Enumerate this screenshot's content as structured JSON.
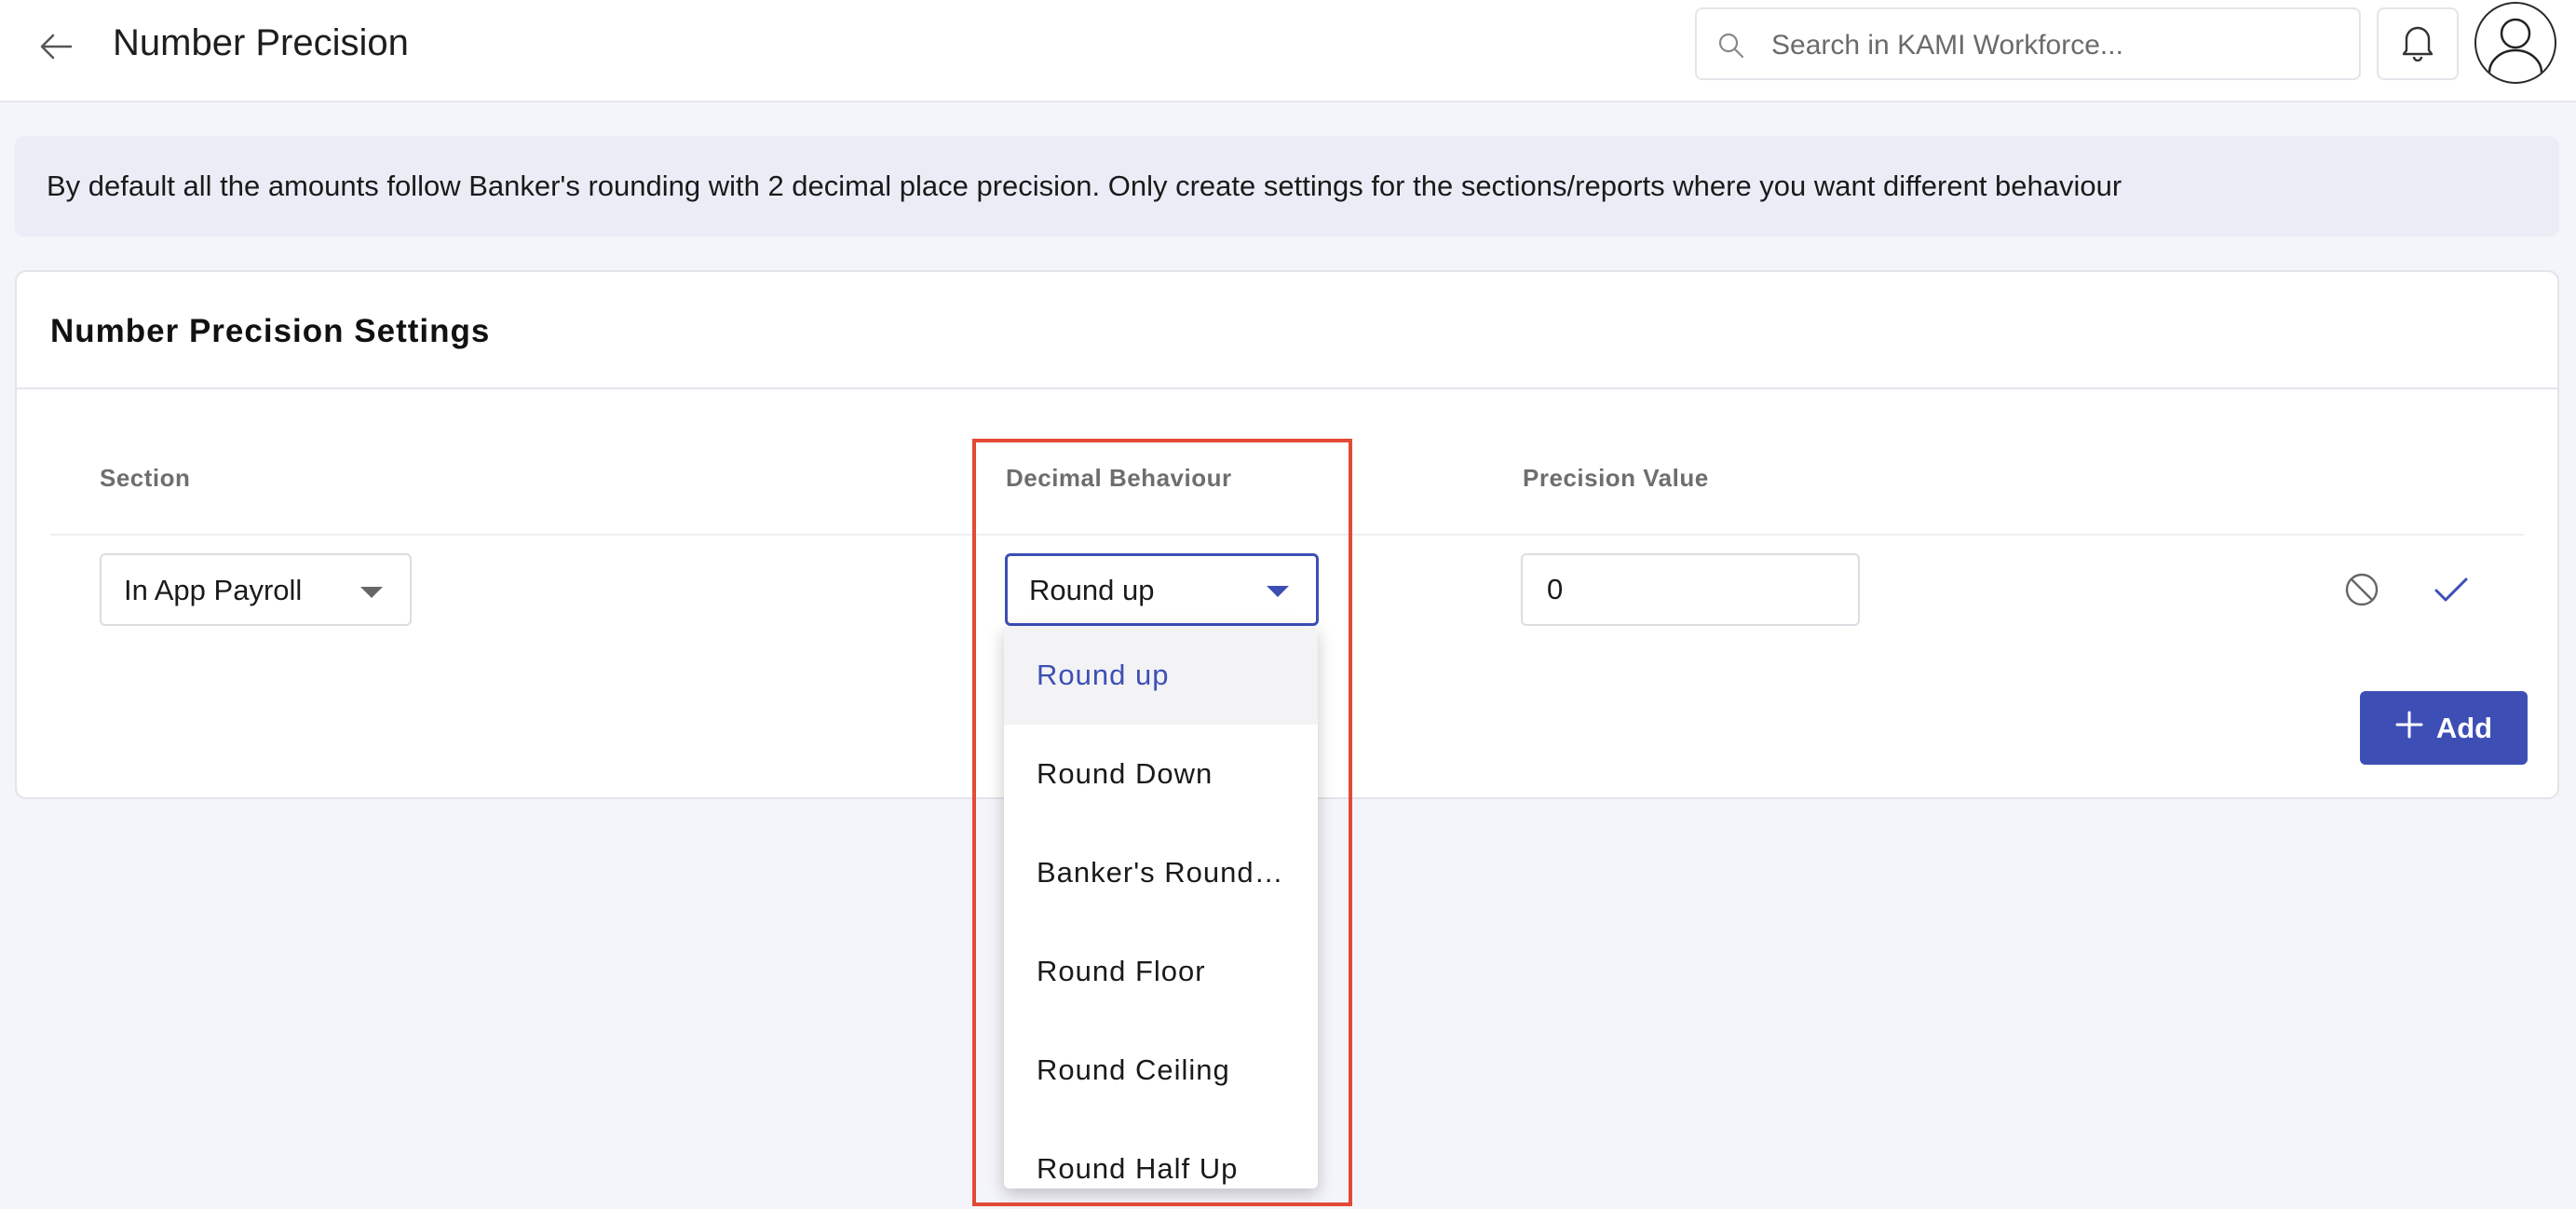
{
  "header": {
    "title": "Number Precision",
    "search_placeholder": "Search in KAMI Workforce..."
  },
  "info_banner": {
    "text": "By default all the amounts follow Banker's rounding with 2 decimal place precision. Only create settings for the sections/reports where you want different behaviour"
  },
  "settings": {
    "title": "Number Precision Settings",
    "columns": {
      "section": "Section",
      "decimal_behaviour": "Decimal Behaviour",
      "precision_value": "Precision Value"
    },
    "row": {
      "section": "In App Payroll",
      "decimal_behaviour": "Round up",
      "precision_value": "0"
    },
    "add_label": "Add"
  },
  "dropdown": {
    "options": [
      "Round up",
      "Round Down",
      "Banker's Roundi…",
      "Round Floor",
      "Round Ceiling",
      "Round Half Up"
    ],
    "selected_index": 0
  },
  "colors": {
    "accent": "#3d4fb5",
    "highlight": "#e24a35",
    "banner_bg": "#eaedf6"
  }
}
